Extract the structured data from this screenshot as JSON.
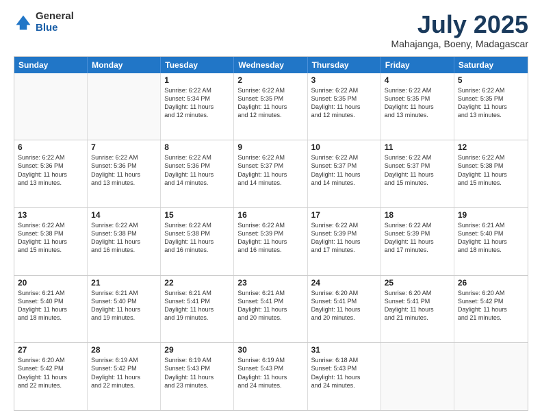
{
  "logo": {
    "general": "General",
    "blue": "Blue"
  },
  "header": {
    "month": "July 2025",
    "location": "Mahajanga, Boeny, Madagascar"
  },
  "days": [
    "Sunday",
    "Monday",
    "Tuesday",
    "Wednesday",
    "Thursday",
    "Friday",
    "Saturday"
  ],
  "weeks": [
    [
      {
        "day": "",
        "empty": true
      },
      {
        "day": "",
        "empty": true
      },
      {
        "day": "1",
        "sunrise": "Sunrise: 6:22 AM",
        "sunset": "Sunset: 5:34 PM",
        "daylight": "Daylight: 11 hours and 12 minutes."
      },
      {
        "day": "2",
        "sunrise": "Sunrise: 6:22 AM",
        "sunset": "Sunset: 5:35 PM",
        "daylight": "Daylight: 11 hours and 12 minutes."
      },
      {
        "day": "3",
        "sunrise": "Sunrise: 6:22 AM",
        "sunset": "Sunset: 5:35 PM",
        "daylight": "Daylight: 11 hours and 12 minutes."
      },
      {
        "day": "4",
        "sunrise": "Sunrise: 6:22 AM",
        "sunset": "Sunset: 5:35 PM",
        "daylight": "Daylight: 11 hours and 13 minutes."
      },
      {
        "day": "5",
        "sunrise": "Sunrise: 6:22 AM",
        "sunset": "Sunset: 5:35 PM",
        "daylight": "Daylight: 11 hours and 13 minutes."
      }
    ],
    [
      {
        "day": "6",
        "sunrise": "Sunrise: 6:22 AM",
        "sunset": "Sunset: 5:36 PM",
        "daylight": "Daylight: 11 hours and 13 minutes."
      },
      {
        "day": "7",
        "sunrise": "Sunrise: 6:22 AM",
        "sunset": "Sunset: 5:36 PM",
        "daylight": "Daylight: 11 hours and 13 minutes."
      },
      {
        "day": "8",
        "sunrise": "Sunrise: 6:22 AM",
        "sunset": "Sunset: 5:36 PM",
        "daylight": "Daylight: 11 hours and 14 minutes."
      },
      {
        "day": "9",
        "sunrise": "Sunrise: 6:22 AM",
        "sunset": "Sunset: 5:37 PM",
        "daylight": "Daylight: 11 hours and 14 minutes."
      },
      {
        "day": "10",
        "sunrise": "Sunrise: 6:22 AM",
        "sunset": "Sunset: 5:37 PM",
        "daylight": "Daylight: 11 hours and 14 minutes."
      },
      {
        "day": "11",
        "sunrise": "Sunrise: 6:22 AM",
        "sunset": "Sunset: 5:37 PM",
        "daylight": "Daylight: 11 hours and 15 minutes."
      },
      {
        "day": "12",
        "sunrise": "Sunrise: 6:22 AM",
        "sunset": "Sunset: 5:38 PM",
        "daylight": "Daylight: 11 hours and 15 minutes."
      }
    ],
    [
      {
        "day": "13",
        "sunrise": "Sunrise: 6:22 AM",
        "sunset": "Sunset: 5:38 PM",
        "daylight": "Daylight: 11 hours and 15 minutes."
      },
      {
        "day": "14",
        "sunrise": "Sunrise: 6:22 AM",
        "sunset": "Sunset: 5:38 PM",
        "daylight": "Daylight: 11 hours and 16 minutes."
      },
      {
        "day": "15",
        "sunrise": "Sunrise: 6:22 AM",
        "sunset": "Sunset: 5:38 PM",
        "daylight": "Daylight: 11 hours and 16 minutes."
      },
      {
        "day": "16",
        "sunrise": "Sunrise: 6:22 AM",
        "sunset": "Sunset: 5:39 PM",
        "daylight": "Daylight: 11 hours and 16 minutes."
      },
      {
        "day": "17",
        "sunrise": "Sunrise: 6:22 AM",
        "sunset": "Sunset: 5:39 PM",
        "daylight": "Daylight: 11 hours and 17 minutes."
      },
      {
        "day": "18",
        "sunrise": "Sunrise: 6:22 AM",
        "sunset": "Sunset: 5:39 PM",
        "daylight": "Daylight: 11 hours and 17 minutes."
      },
      {
        "day": "19",
        "sunrise": "Sunrise: 6:21 AM",
        "sunset": "Sunset: 5:40 PM",
        "daylight": "Daylight: 11 hours and 18 minutes."
      }
    ],
    [
      {
        "day": "20",
        "sunrise": "Sunrise: 6:21 AM",
        "sunset": "Sunset: 5:40 PM",
        "daylight": "Daylight: 11 hours and 18 minutes."
      },
      {
        "day": "21",
        "sunrise": "Sunrise: 6:21 AM",
        "sunset": "Sunset: 5:40 PM",
        "daylight": "Daylight: 11 hours and 19 minutes."
      },
      {
        "day": "22",
        "sunrise": "Sunrise: 6:21 AM",
        "sunset": "Sunset: 5:41 PM",
        "daylight": "Daylight: 11 hours and 19 minutes."
      },
      {
        "day": "23",
        "sunrise": "Sunrise: 6:21 AM",
        "sunset": "Sunset: 5:41 PM",
        "daylight": "Daylight: 11 hours and 20 minutes."
      },
      {
        "day": "24",
        "sunrise": "Sunrise: 6:20 AM",
        "sunset": "Sunset: 5:41 PM",
        "daylight": "Daylight: 11 hours and 20 minutes."
      },
      {
        "day": "25",
        "sunrise": "Sunrise: 6:20 AM",
        "sunset": "Sunset: 5:41 PM",
        "daylight": "Daylight: 11 hours and 21 minutes."
      },
      {
        "day": "26",
        "sunrise": "Sunrise: 6:20 AM",
        "sunset": "Sunset: 5:42 PM",
        "daylight": "Daylight: 11 hours and 21 minutes."
      }
    ],
    [
      {
        "day": "27",
        "sunrise": "Sunrise: 6:20 AM",
        "sunset": "Sunset: 5:42 PM",
        "daylight": "Daylight: 11 hours and 22 minutes."
      },
      {
        "day": "28",
        "sunrise": "Sunrise: 6:19 AM",
        "sunset": "Sunset: 5:42 PM",
        "daylight": "Daylight: 11 hours and 22 minutes."
      },
      {
        "day": "29",
        "sunrise": "Sunrise: 6:19 AM",
        "sunset": "Sunset: 5:43 PM",
        "daylight": "Daylight: 11 hours and 23 minutes."
      },
      {
        "day": "30",
        "sunrise": "Sunrise: 6:19 AM",
        "sunset": "Sunset: 5:43 PM",
        "daylight": "Daylight: 11 hours and 24 minutes."
      },
      {
        "day": "31",
        "sunrise": "Sunrise: 6:18 AM",
        "sunset": "Sunset: 5:43 PM",
        "daylight": "Daylight: 11 hours and 24 minutes."
      },
      {
        "day": "",
        "empty": true
      },
      {
        "day": "",
        "empty": true
      }
    ]
  ]
}
